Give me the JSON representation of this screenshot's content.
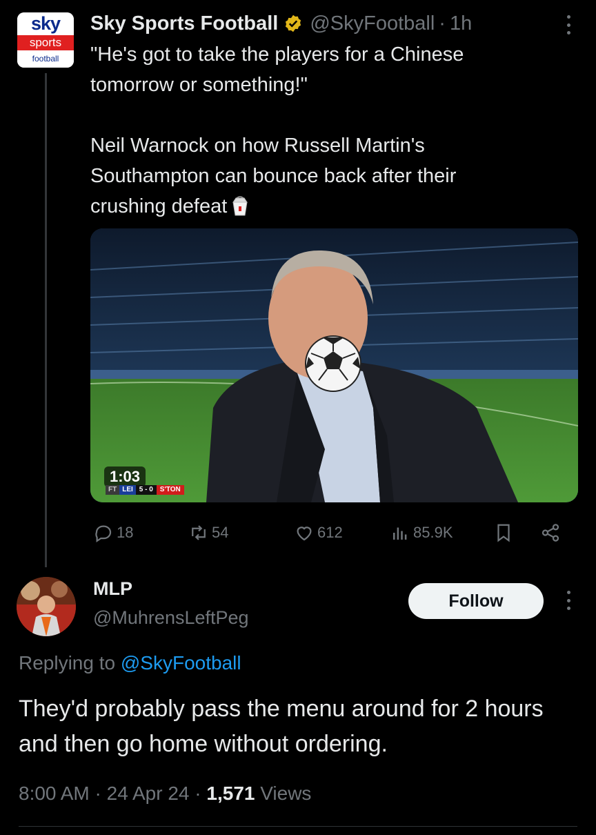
{
  "post": {
    "logo": {
      "top": "sky",
      "middle": "sports",
      "bottom": "football"
    },
    "author_name": "Sky Sports Football",
    "handle": "@SkyFootball",
    "separator": "·",
    "time": "1h",
    "text_line1": "\"He's got to take the players for a Chinese",
    "text_line2": "tomorrow or something!\"",
    "text_para2_line1": "Neil Warnock on how Russell Martin's",
    "text_para2_line2": "Southampton can bounce back after their",
    "text_para2_line3": "crushing defeat",
    "video": {
      "duration": "1:03",
      "scorebug": {
        "status": "FT",
        "home": "LEI",
        "score": "5 - 0",
        "away": "S'TON"
      }
    },
    "stats": {
      "replies": "18",
      "reposts": "54",
      "likes": "612",
      "views": "85.9K"
    },
    "icons": {
      "verified": "verified-badge-icon",
      "reply": "reply-icon",
      "repost": "repost-icon",
      "like": "heart-icon",
      "views": "views-icon",
      "bookmark": "bookmark-icon",
      "share": "share-icon",
      "more": "more-icon",
      "emoji": "takeout-box-icon",
      "face_cover": "soccer-ball-icon"
    }
  },
  "reply": {
    "name": "MLP",
    "handle": "@MuhrensLeftPeg",
    "follow_label": "Follow",
    "replying_prefix": "Replying to",
    "replying_to": "@SkyFootball",
    "text": "They'd probably pass the menu around for 2 hours and then go home without ordering.",
    "time": "8:00 AM",
    "date": "24 Apr 24",
    "views_count": "1,571",
    "views_label": "Views",
    "separator": "·"
  },
  "colors": {
    "background": "#000000",
    "text": "#e7e9ea",
    "muted": "#71767b",
    "link": "#1d9bf0",
    "verified": "#e2b719"
  }
}
